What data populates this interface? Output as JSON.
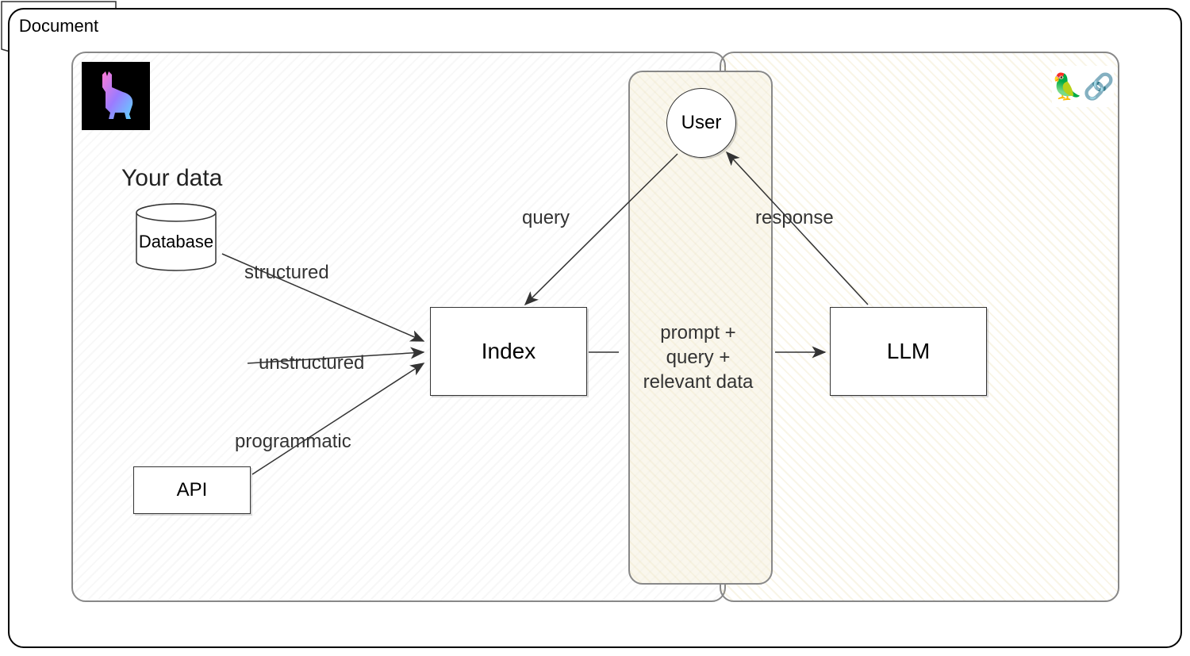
{
  "diagram": {
    "heading": "Your data",
    "nodes": {
      "database": "Database",
      "document": "Document",
      "api": "API",
      "index": "Index",
      "user": "User",
      "llm": "LLM"
    },
    "edges": {
      "structured": "structured",
      "unstructured": "unstructured",
      "programmatic": "programmatic",
      "query": "query",
      "response": "response",
      "promptLine1": "prompt +",
      "promptLine2": "query +",
      "promptLine3": "relevant data"
    },
    "logos": {
      "parrotEmoji": "🦜",
      "chainEmoji": "🔗"
    }
  }
}
